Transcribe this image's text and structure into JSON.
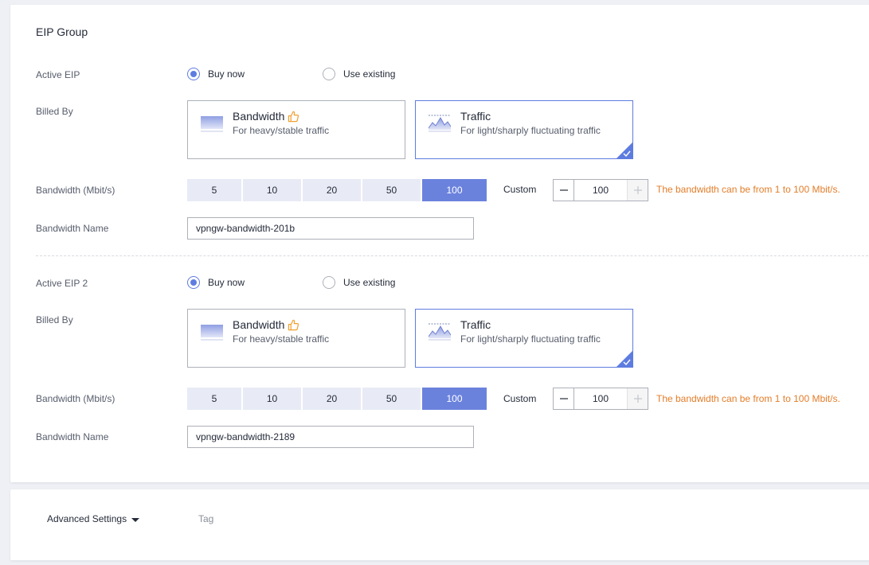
{
  "title": "EIP Group",
  "groups": [
    {
      "active_label": "Active EIP",
      "radio_buy": "Buy now",
      "radio_existing": "Use existing",
      "billed_label": "Billed By",
      "card_bw_title": "Bandwidth",
      "card_bw_desc": "For heavy/stable traffic",
      "card_tr_title": "Traffic",
      "card_tr_desc": "For light/sharply fluctuating traffic",
      "bw_label": "Bandwidth (Mbit/s)",
      "options": [
        "5",
        "10",
        "20",
        "50",
        "100"
      ],
      "selected_option": "100",
      "custom_label": "Custom",
      "custom_value": "100",
      "hint": "The bandwidth can be from 1 to 100 Mbit/s.",
      "name_label": "Bandwidth Name",
      "name_value": "vpngw-bandwidth-201b"
    },
    {
      "active_label": "Active EIP 2",
      "radio_buy": "Buy now",
      "radio_existing": "Use existing",
      "billed_label": "Billed By",
      "card_bw_title": "Bandwidth",
      "card_bw_desc": "For heavy/stable traffic",
      "card_tr_title": "Traffic",
      "card_tr_desc": "For light/sharply fluctuating traffic",
      "bw_label": "Bandwidth (Mbit/s)",
      "options": [
        "5",
        "10",
        "20",
        "50",
        "100"
      ],
      "selected_option": "100",
      "custom_label": "Custom",
      "custom_value": "100",
      "hint": "The bandwidth can be from 1 to 100 Mbit/s.",
      "name_label": "Bandwidth Name",
      "name_value": "vpngw-bandwidth-2189"
    }
  ],
  "advanced": {
    "label": "Advanced Settings",
    "tag": "Tag"
  },
  "colors": {
    "accent": "#5e7ce0",
    "selected_segment": "#6b82dd",
    "hint": "#e37d29",
    "recommend_icon": "#f0a030"
  },
  "icons": {
    "recommend": "thumbs-up-icon",
    "bandwidth": "bandwidth-chart-icon",
    "traffic": "traffic-chart-icon",
    "check": "check-icon",
    "minus": "minus-icon",
    "plus": "plus-icon",
    "caret": "caret-down-icon"
  }
}
